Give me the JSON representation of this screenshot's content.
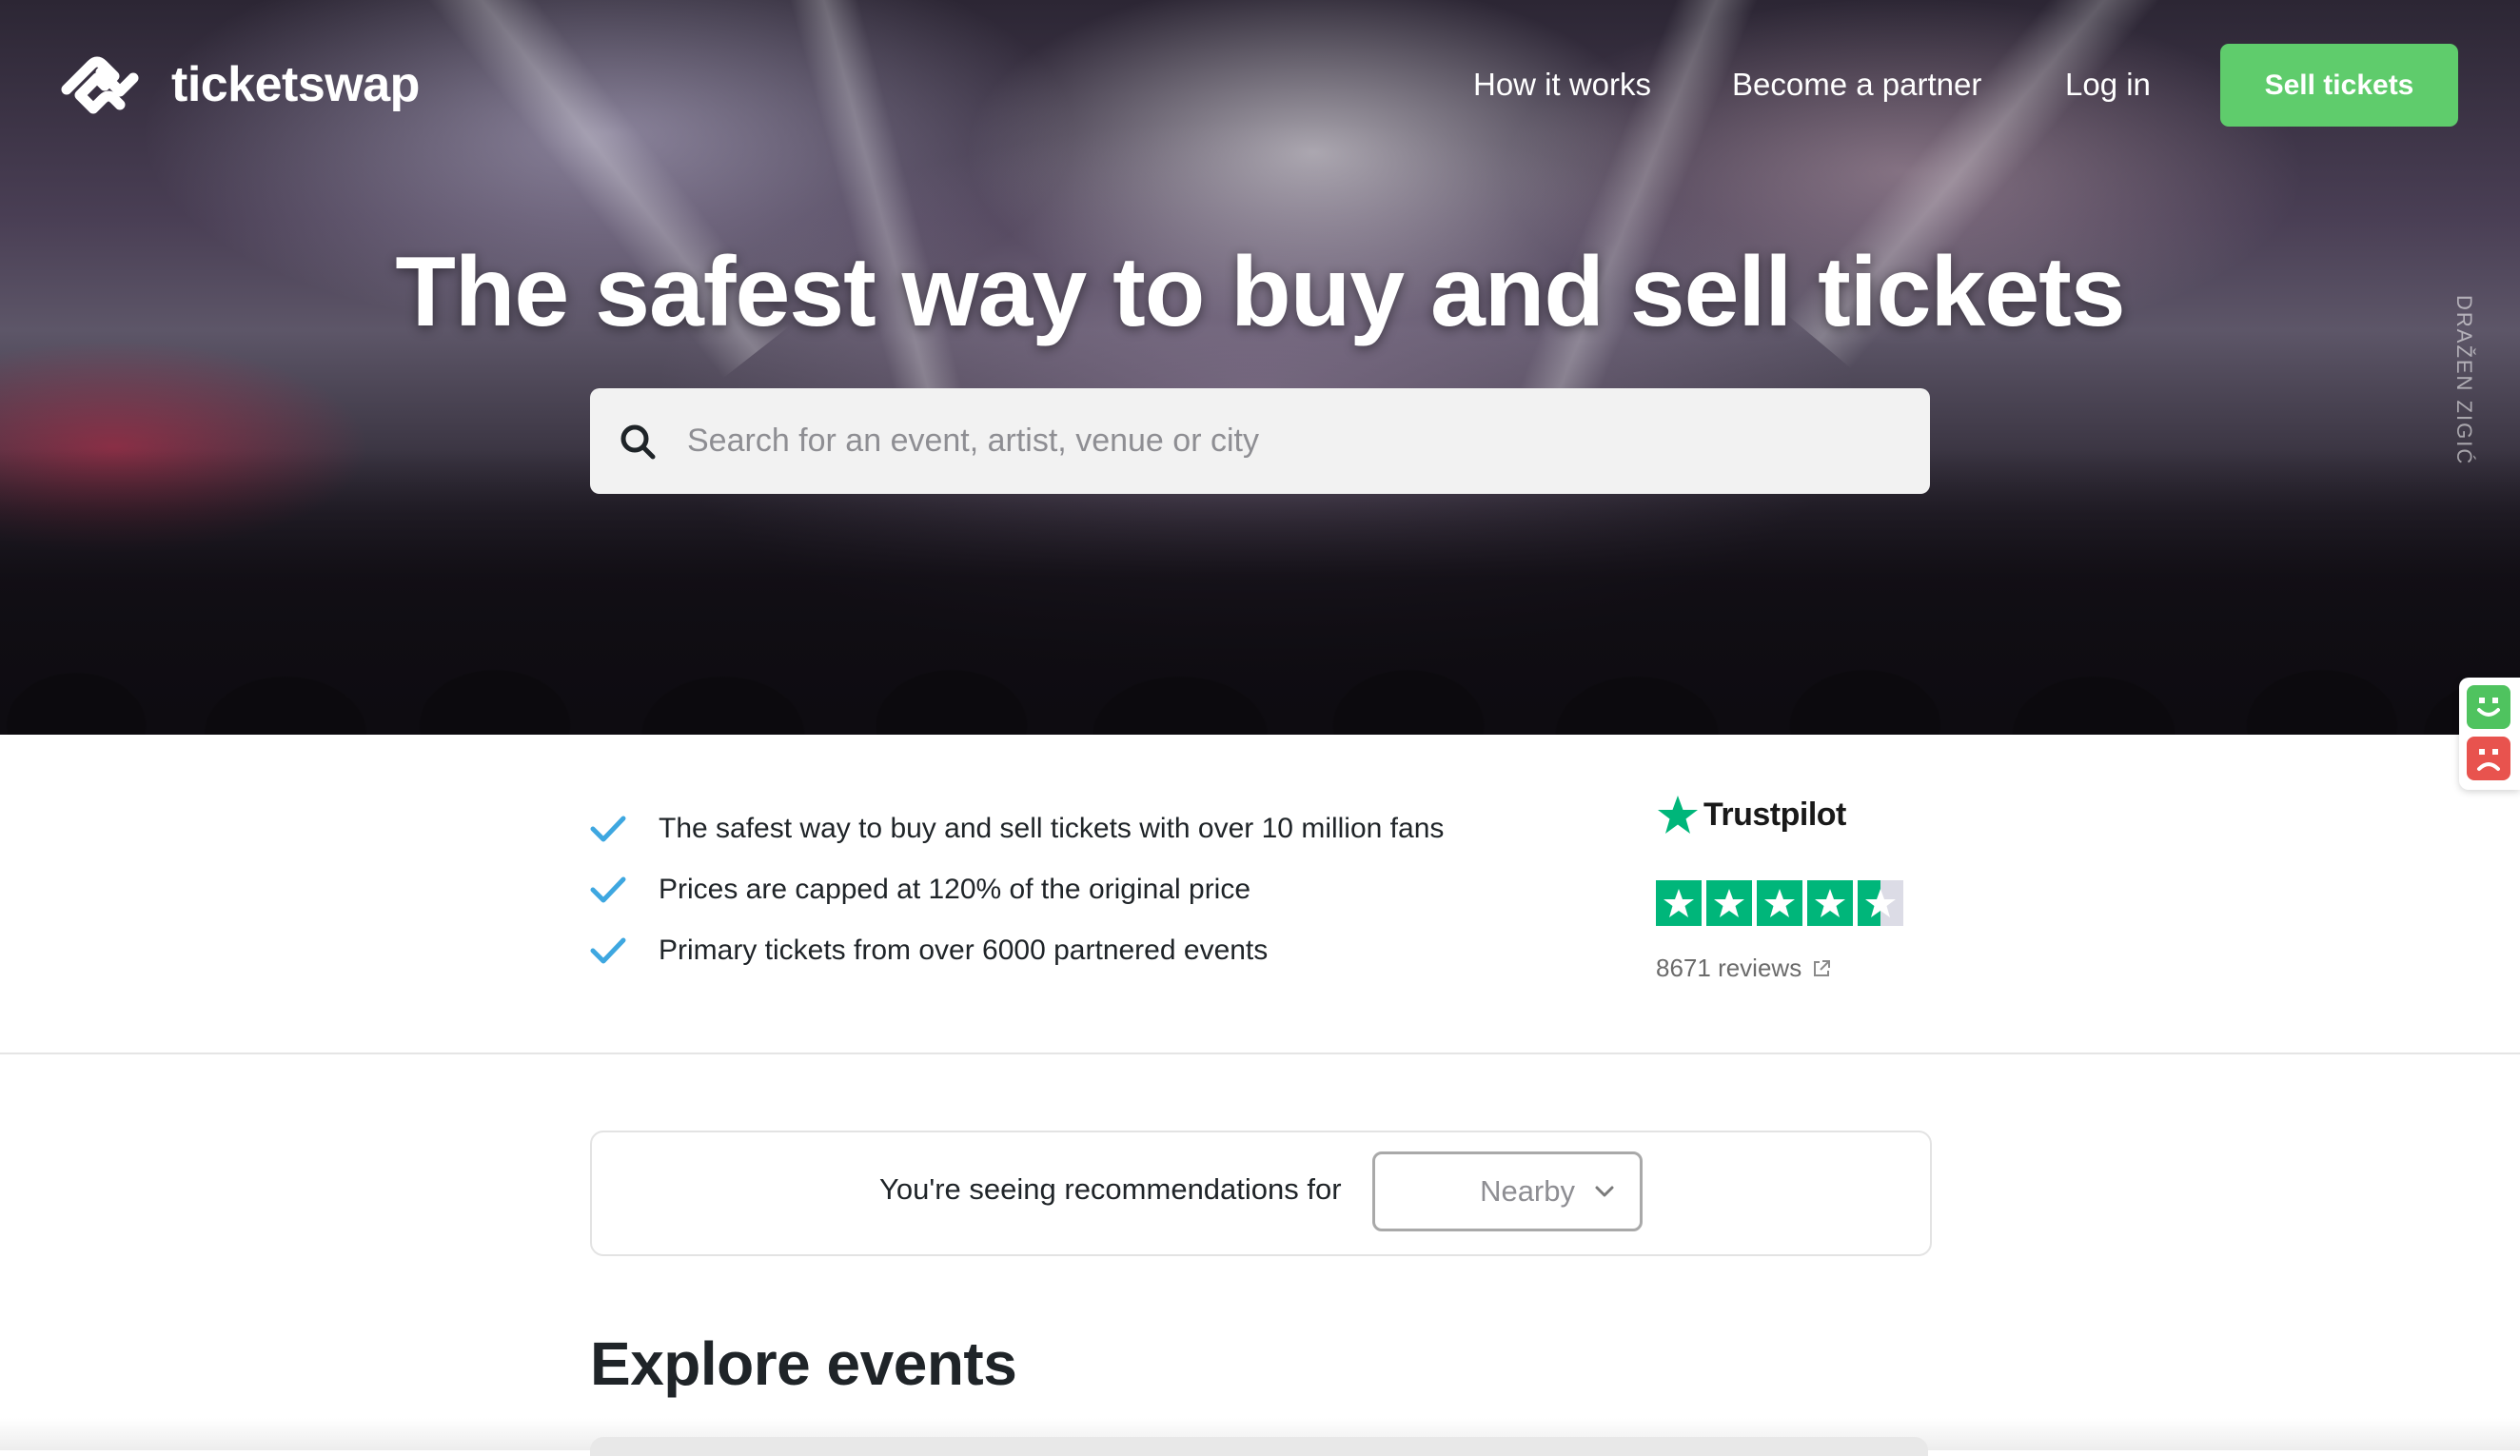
{
  "brand": {
    "name": "ticketswap"
  },
  "nav": {
    "how_it_works": "How it works",
    "become_partner": "Become a partner",
    "log_in": "Log in",
    "sell_tickets": "Sell tickets"
  },
  "hero": {
    "title": "The safest way to buy and sell tickets",
    "search_placeholder": "Search for an event, artist, venue or city",
    "photo_credit": "DRAŽEN ZIGIĆ"
  },
  "features": [
    {
      "text": "The safest way to buy and sell tickets with over 10 million fans",
      "icon": "check-icon"
    },
    {
      "text": "Prices are capped at 120% of the original price",
      "icon": "check-icon"
    },
    {
      "text": "Primary tickets from over 6000 partnered events",
      "icon": "check-icon"
    }
  ],
  "trustpilot": {
    "name": "Trustpilot",
    "rating_stars": 4.5,
    "reviews_label": "8671 reviews"
  },
  "recommendations": {
    "label": "You're seeing recommendations for",
    "selected": "Nearby"
  },
  "explore": {
    "title": "Explore events"
  },
  "colors": {
    "accent_green": "#5fcc6c",
    "check_blue": "#3ea7e0",
    "trustpilot_green": "#00b67a",
    "feedback_happy": "#4fc35f",
    "feedback_sad": "#e8534e"
  }
}
